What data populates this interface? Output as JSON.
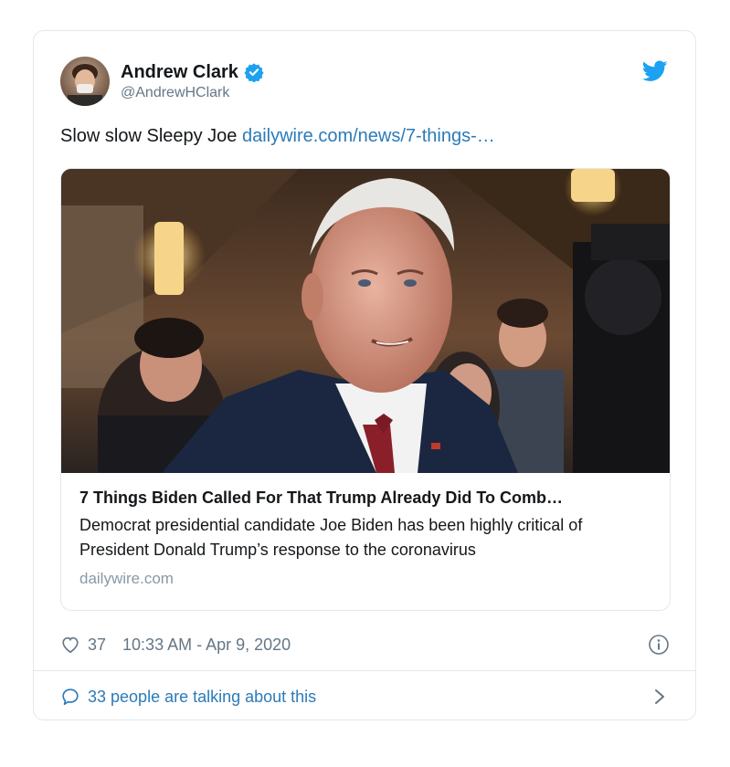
{
  "tweet": {
    "author": {
      "display_name": "Andrew Clark",
      "handle": "@AndrewHClark",
      "verified": true,
      "avatar_icon": "profile-photo"
    },
    "text": "Slow slow Sleepy Joe ",
    "link_text": "dailywire.com/news/7-things-…",
    "card": {
      "image_icon": "news-photo",
      "title": "7 Things Biden Called For That Trump Already Did To Comb…",
      "description": "Democrat presidential candidate Joe Biden has been highly critical of President Donald Trump’s response to the coronavirus",
      "domain": "dailywire.com"
    },
    "likes": "37",
    "timestamp": "10:33 AM - Apr 9, 2020",
    "talking": "33 people are talking about this"
  },
  "colors": {
    "link": "#2b7bb9",
    "twitter_blue": "#1da1f2",
    "muted": "#657786",
    "border": "#e1e8ed"
  }
}
